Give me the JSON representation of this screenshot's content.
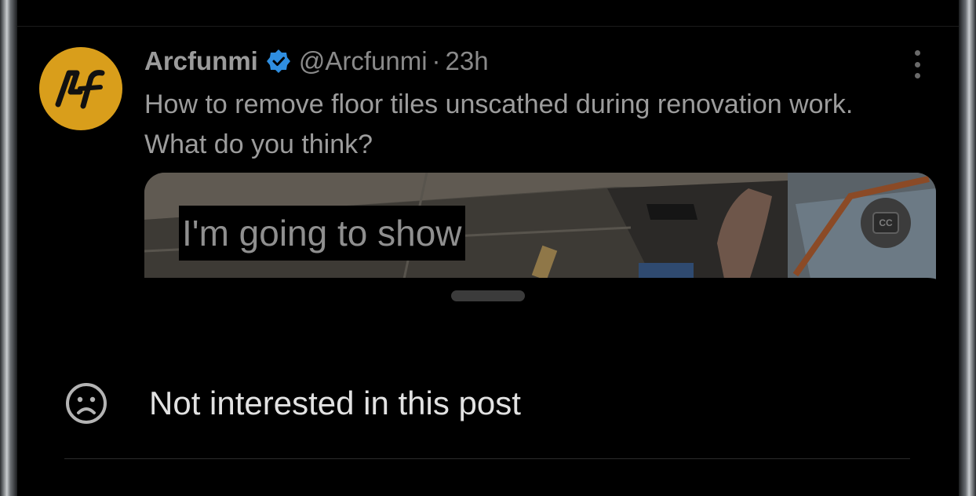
{
  "post": {
    "author_name": "Arcfunmi",
    "handle": "@Arcfunmi",
    "separator": "·",
    "time": "23h",
    "text": "How to remove floor tiles unscathed during renovation work. What do you think?",
    "avatar_icon": "arcfunmi-logo-icon",
    "verified_icon": "verified-badge-icon",
    "more_icon": "more-vertical-icon",
    "colors": {
      "avatar": "#d99e1b",
      "verified": "#2f8ee0"
    }
  },
  "media": {
    "caption": "I'm going to show",
    "cc_label": "CC",
    "cc_icon": "closed-captions-icon"
  },
  "sheet": {
    "handle_icon": "drag-handle",
    "items": [
      {
        "label": "Not interested in this post",
        "icon": "sad-face-icon"
      }
    ]
  }
}
